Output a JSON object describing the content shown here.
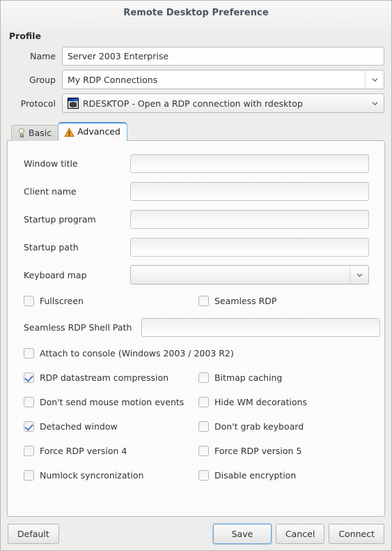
{
  "window": {
    "title": "Remote Desktop Preference"
  },
  "profile": {
    "heading": "Profile",
    "fields": {
      "name": {
        "label": "Name",
        "value": "Server 2003 Enterprise",
        "placeholder": ""
      },
      "group": {
        "label": "Group",
        "value": "My RDP Connections",
        "options": [
          "My RDP Connections"
        ]
      },
      "protocol": {
        "label": "Protocol",
        "value": "RDESKTOP - Open a RDP connection with rdesktop",
        "icon": "rdesktop-icon",
        "options": [
          "RDESKTOP - Open a RDP connection with rdesktop"
        ]
      }
    }
  },
  "tabs": [
    {
      "label": "Basic",
      "icon": "lightbulb-icon",
      "active": false
    },
    {
      "label": "Advanced",
      "icon": "warning-triangle-icon",
      "active": true
    }
  ],
  "advanced": {
    "text_fields": [
      {
        "label": "Window title",
        "value": "",
        "placeholder": ""
      },
      {
        "label": "Client name",
        "value": "",
        "placeholder": ""
      },
      {
        "label": "Startup program",
        "value": "",
        "placeholder": ""
      },
      {
        "label": "Startup path",
        "value": "",
        "placeholder": ""
      }
    ],
    "keyboard_map": {
      "label": "Keyboard map",
      "value": "",
      "options": []
    },
    "fullscreen_row": {
      "left": {
        "label": "Fullscreen",
        "checked": false
      },
      "right": {
        "label": "Seamless RDP",
        "checked": false
      }
    },
    "shell_path": {
      "label": "Seamless RDP Shell Path",
      "value": "",
      "placeholder": ""
    },
    "attach_console": {
      "label": "Attach to console (Windows 2003 / 2003 R2)",
      "checked": false
    },
    "checkbox_rows": [
      {
        "left": {
          "label": "RDP datastream compression",
          "checked": true
        },
        "right": {
          "label": "Bitmap caching",
          "checked": false
        }
      },
      {
        "left": {
          "label": "Don't send mouse motion events",
          "checked": false
        },
        "right": {
          "label": "Hide WM decorations",
          "checked": false
        }
      },
      {
        "left": {
          "label": "Detached window",
          "checked": true
        },
        "right": {
          "label": "Don't grab keyboard",
          "checked": false
        }
      },
      {
        "left": {
          "label": "Force RDP version 4",
          "checked": false
        },
        "right": {
          "label": "Force RDP version 5",
          "checked": false
        }
      },
      {
        "left": {
          "label": "Numlock syncronization",
          "checked": false
        },
        "right": {
          "label": "Disable encryption",
          "checked": false
        }
      }
    ]
  },
  "actions": {
    "default": "Default",
    "save": "Save",
    "cancel": "Cancel",
    "connect": "Connect"
  },
  "colors": {
    "title_text": "#46555f",
    "accent_focus": "#4a90d9",
    "check_blue": "#4a7cc4",
    "warning_orange": "#e8820c",
    "window_bg": "#ededec",
    "panel_bg": "#fbfbfb"
  }
}
